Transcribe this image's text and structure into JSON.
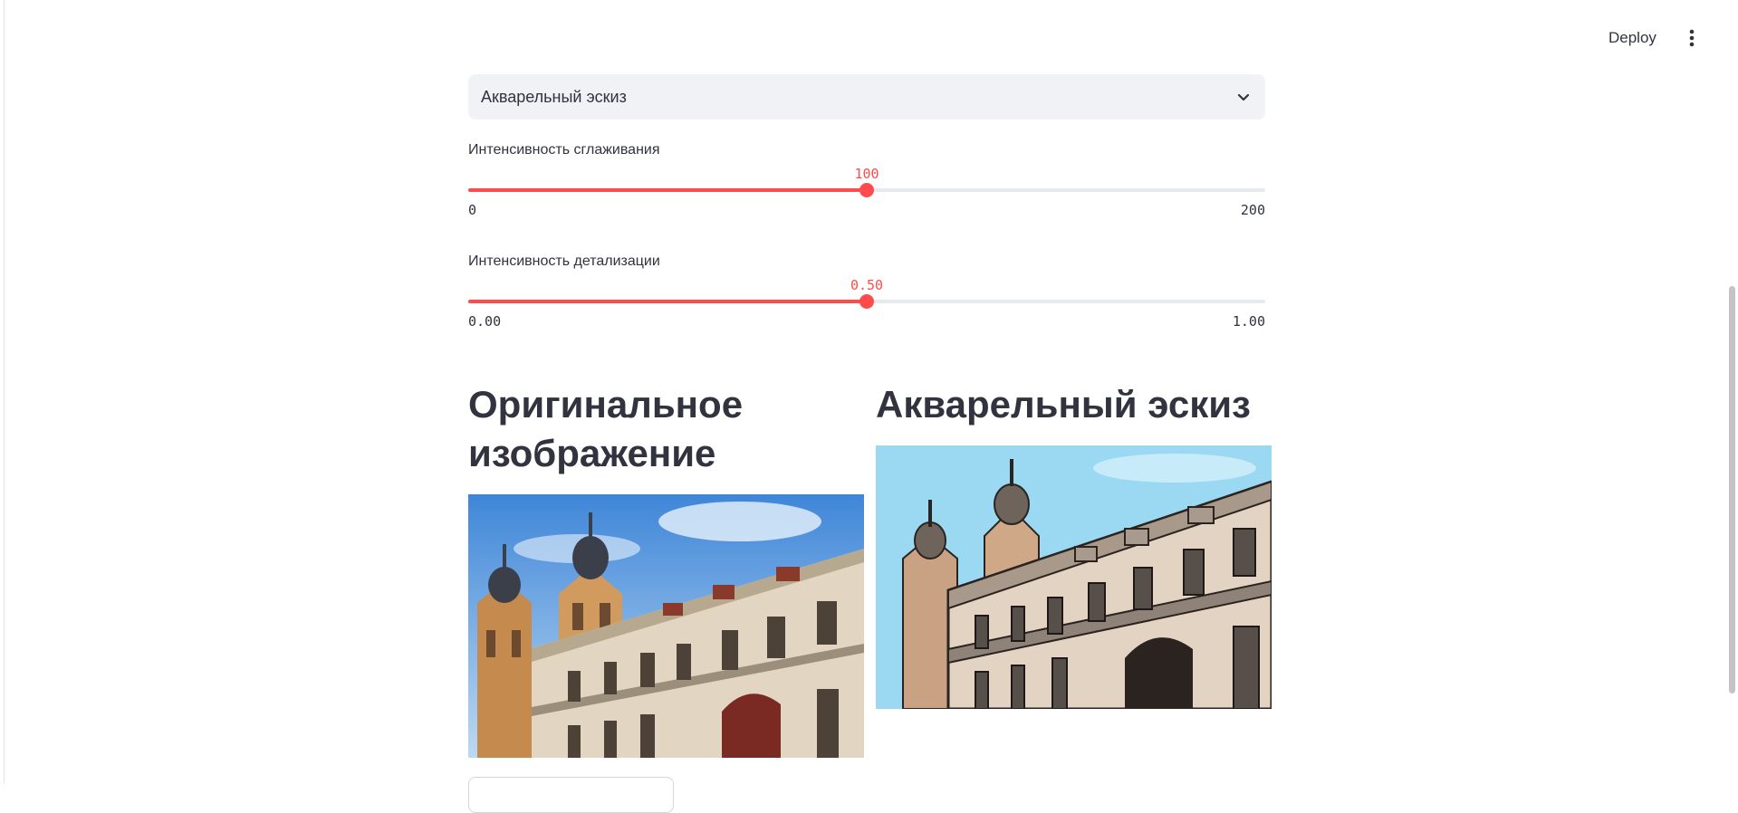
{
  "header": {
    "deploy_label": "Deploy",
    "menu_icon": "more-vertical-icon"
  },
  "filter_select": {
    "value": "Акварельный эскиз",
    "icon": "chevron-down-icon"
  },
  "sliders": [
    {
      "label": "Интенсивность сглаживания",
      "value": "100",
      "min": "0",
      "max": "200",
      "fraction": 0.5
    },
    {
      "label": "Интенсивность детализации",
      "value": "0.50",
      "min": "0.00",
      "max": "1.00",
      "fraction": 0.5
    }
  ],
  "columns": {
    "original_title": "Оригинальное изображение",
    "result_title": "Акварельный эскиз"
  },
  "colors": {
    "accent": "#ff4b4b",
    "text": "#31333f",
    "track": "#e6e9ef",
    "select_bg": "#f0f2f6"
  }
}
